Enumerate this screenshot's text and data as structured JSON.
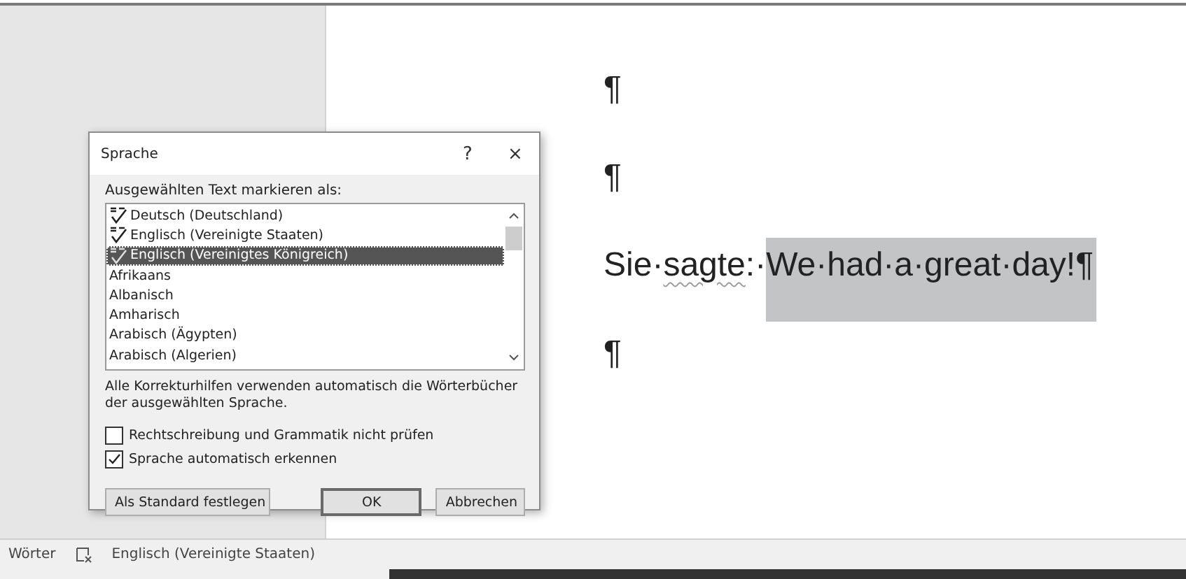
{
  "document": {
    "paragraphs": [
      {
        "segments": [
          {
            "text": "¶",
            "selected": false,
            "misspelled": false
          }
        ]
      },
      {
        "segments": [
          {
            "text": "¶",
            "selected": false,
            "misspelled": false
          }
        ]
      },
      {
        "segments": [
          {
            "text": "Sie·",
            "selected": false,
            "misspelled": false
          },
          {
            "text": "sagte",
            "selected": false,
            "misspelled": true
          },
          {
            "text": ":·",
            "selected": false,
            "misspelled": false
          },
          {
            "text": "We·had·a·great·day!¶",
            "selected": true,
            "misspelled": false
          }
        ]
      },
      {
        "segments": [
          {
            "text": "¶",
            "selected": false,
            "misspelled": false
          }
        ]
      }
    ]
  },
  "dialog": {
    "title": "Sprache",
    "help": "?",
    "close": "×",
    "list_label": "Ausgewählten Text markieren als:",
    "languages": [
      {
        "name": "Deutsch (Deutschland)",
        "proofing": true,
        "selected": false
      },
      {
        "name": "Englisch (Vereinigte Staaten)",
        "proofing": true,
        "selected": false
      },
      {
        "name": "Englisch (Vereinigtes Königreich)",
        "proofing": true,
        "selected": true
      },
      {
        "name": "Afrikaans",
        "proofing": false,
        "selected": false
      },
      {
        "name": "Albanisch",
        "proofing": false,
        "selected": false
      },
      {
        "name": "Amharisch",
        "proofing": false,
        "selected": false
      },
      {
        "name": "Arabisch (Ägypten)",
        "proofing": false,
        "selected": false
      },
      {
        "name": "Arabisch (Algerien)",
        "proofing": false,
        "selected": false
      }
    ],
    "note": "Alle Korrekturhilfen verwenden automatisch die Wörterbücher der ausgewählten Sprache.",
    "checkboxes": [
      {
        "label": "Rechtschreibung und Grammatik nicht prüfen",
        "checked": false
      },
      {
        "label": "Sprache automatisch erkennen",
        "checked": true
      }
    ],
    "buttons": [
      {
        "label": "Als Standard festlegen",
        "default": false
      },
      {
        "label": "OK",
        "default": true
      },
      {
        "label": "Abbrechen",
        "default": false
      }
    ]
  },
  "status_bar": {
    "words": "Wörter",
    "language": "Englisch (Vereinigte Staaten)"
  }
}
